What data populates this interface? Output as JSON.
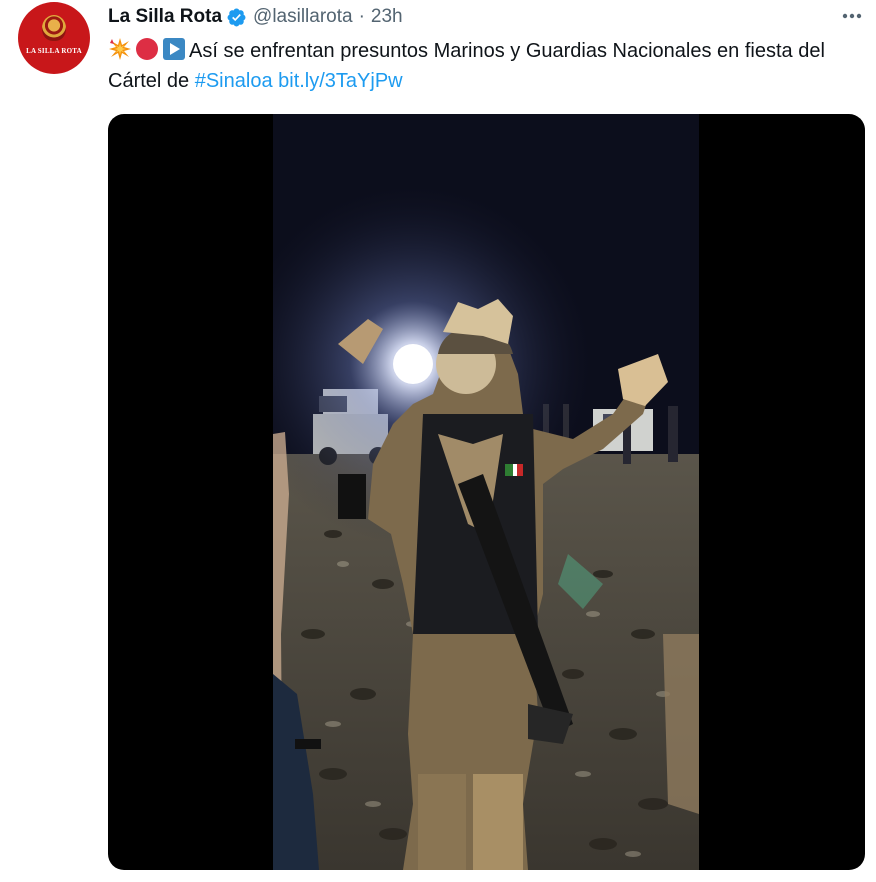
{
  "tweet": {
    "display_name": "La Silla Rota",
    "verified": true,
    "handle": "@lasillarota",
    "separator": "·",
    "time": "23h",
    "avatar_text": "LA SILLA ROTA",
    "text_main": "Así se enfrentan presuntos Marinos y Guardias Nacionales en fiesta del Cártel de ",
    "hashtag": "#Sinaloa",
    "link": "bit.ly/3TaYjPw",
    "emojis": [
      "collision-emoji",
      "red-circle-emoji",
      "play-button-emoji"
    ]
  },
  "colors": {
    "accent": "#1d9bf0",
    "text": "#0f1419",
    "secondary": "#536471",
    "avatar_bg": "#c8171a"
  },
  "media": {
    "type": "video",
    "description_icon": "video-thumbnail"
  }
}
